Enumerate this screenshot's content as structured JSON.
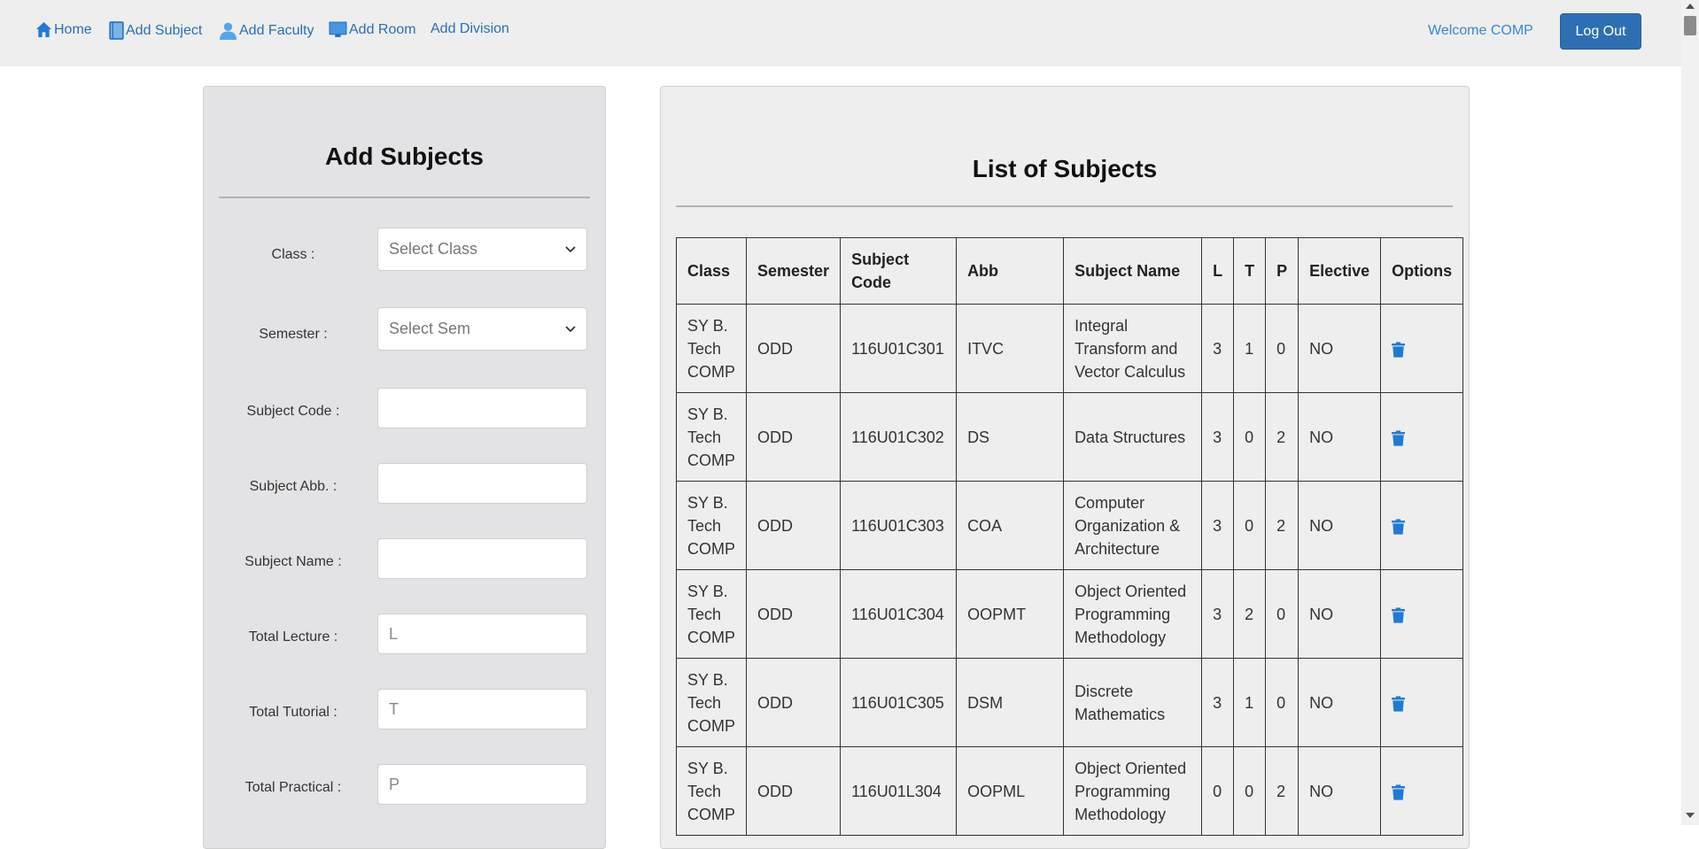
{
  "nav": {
    "home": "Home",
    "add_subject": "Add Subject",
    "add_faculty": "Add Faculty",
    "add_room": "Add Room",
    "add_division": "Add Division",
    "welcome": "Welcome COMP",
    "logout": "Log Out"
  },
  "form": {
    "title": "Add Subjects",
    "fields": [
      {
        "label": "Class :",
        "placeholder": "Select Class",
        "type": "select"
      },
      {
        "label": "Semester :",
        "placeholder": "Select Sem",
        "type": "select"
      },
      {
        "label": "Subject Code :",
        "placeholder": "",
        "type": "text"
      },
      {
        "label": "Subject Abb. :",
        "placeholder": "",
        "type": "text"
      },
      {
        "label": "Subject Name :",
        "placeholder": "",
        "type": "text"
      },
      {
        "label": "Total Lecture :",
        "placeholder": "L",
        "type": "text"
      },
      {
        "label": "Total Tutorial :",
        "placeholder": "T",
        "type": "text"
      },
      {
        "label": "Total Practical :",
        "placeholder": "P",
        "type": "text"
      }
    ]
  },
  "list": {
    "title": "List of Subjects",
    "columns": [
      "Class",
      "Semester",
      "Subject Code",
      "Abb",
      "Subject Name",
      "L",
      "T",
      "P",
      "Elective",
      "Options"
    ],
    "rows": [
      [
        "SY B. Tech COMP",
        "ODD",
        "116U01C301",
        "ITVC",
        "Integral Transform and Vector Calculus",
        "3",
        "1",
        "0",
        "NO"
      ],
      [
        "SY B. Tech COMP",
        "ODD",
        "116U01C302",
        "DS",
        "Data Structures",
        "3",
        "0",
        "2",
        "NO"
      ],
      [
        "SY B. Tech COMP",
        "ODD",
        "116U01C303",
        "COA",
        "Computer Organization & Architecture",
        "3",
        "0",
        "2",
        "NO"
      ],
      [
        "SY B. Tech COMP",
        "ODD",
        "116U01C304",
        "OOPMT",
        "Object Oriented Programming Methodology",
        "3",
        "2",
        "0",
        "NO"
      ],
      [
        "SY B. Tech COMP",
        "ODD",
        "116U01C305",
        "DSM",
        "Discrete Mathematics",
        "3",
        "1",
        "0",
        "NO"
      ],
      [
        "SY B. Tech COMP",
        "ODD",
        "116U01L304",
        "OOPML",
        "Object Oriented Programming Methodology",
        "0",
        "0",
        "2",
        "NO"
      ]
    ]
  },
  "icons": {
    "home": "home-icon",
    "book": "book-icon",
    "user": "user-icon",
    "room": "monitor-icon",
    "delete": "trash-icon"
  },
  "colors": {
    "accent": "#2e6fb3",
    "link": "#2a6fb5",
    "icon": "#1f7ad6"
  }
}
